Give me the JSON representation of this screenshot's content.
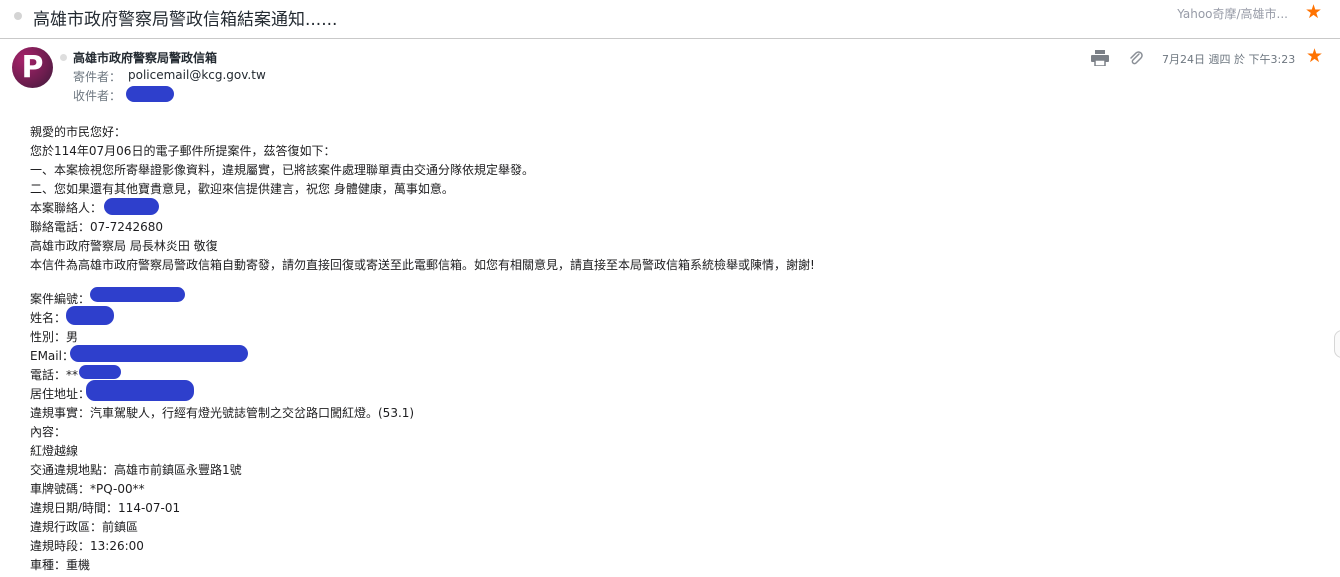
{
  "subject": {
    "title": "高雄市政府警察局警政信箱結案通知......",
    "folder": "Yahoo奇摩/高雄市..."
  },
  "header": {
    "avatar_letter": "P",
    "from_name": "高雄市政府警察局警政信箱",
    "from_label": "寄件者：",
    "from_email": "policemail@kcg.gov.tw",
    "to_label": "收件者：",
    "date": "7月24日 週四 於 下午3:23"
  },
  "icons": {
    "print": "print-icon",
    "attachment": "paperclip-icon",
    "star": "star-icon"
  },
  "colors": {
    "accent_star": "#ff7200",
    "redaction": "#2e3fcc",
    "avatar": "#8a1f5c"
  },
  "body": {
    "greeting": "親愛的市民您好：",
    "l1": "您於114年07月06日的電子郵件所提案件，茲答復如下：",
    "l2": "一、本案檢視您所寄舉證影像資料，違規屬實，已將該案件處理聯單責由交通分隊依規定舉發。",
    "l3": "二、您如果還有其他寶貴意見，歡迎來信提供建言，祝您 身體健康，萬事如意。",
    "contact_label": "本案聯絡人：",
    "phone_line": "聯絡電話：07-7242680",
    "signature": "高雄市政府警察局 局長林炎田 敬復",
    "notice": "本信件為高雄市政府警察局警政信箱自動寄發，請勿直接回復或寄送至此電郵信箱。如您有相關意見，請直接至本局警政信箱系統檢舉或陳情，謝謝!",
    "case_no_label": "案件編號：",
    "name_label": "姓名：",
    "gender_line": "性別：男",
    "email_label": "EMail：",
    "tel_label": "電話：**",
    "address_label": "居住地址：",
    "violation_fact": "違規事實：汽車駕駛人，行經有燈光號誌管制之交岔路口闖紅燈。(53.1)",
    "content_label": "內容：",
    "content_value": "紅燈越線",
    "location": "交通違規地點：高雄市前鎮區永豐路1號",
    "plate": "車牌號碼：*PQ-00**",
    "date_line": "違規日期/時間：114-07-01",
    "district": "違規行政區：前鎮區",
    "time_slot": "違規時段：13:26:00",
    "vehicle": "車種：重機"
  }
}
